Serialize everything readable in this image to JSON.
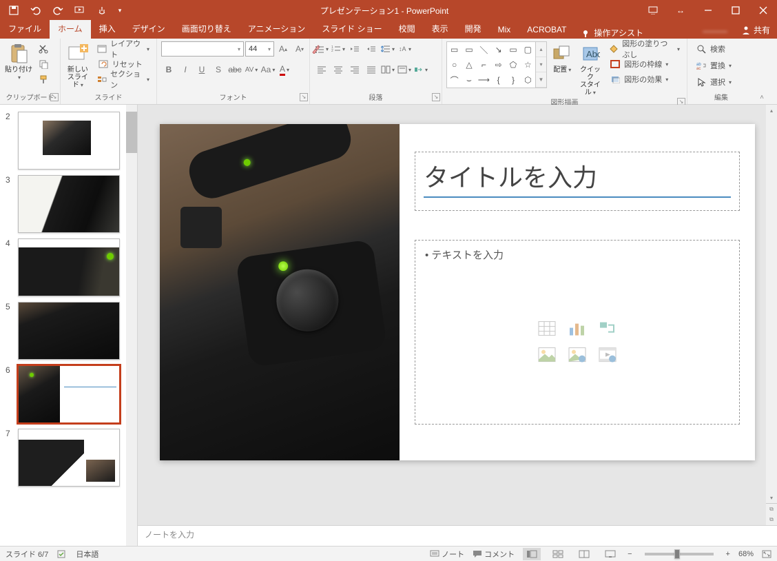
{
  "titlebar": {
    "title_doc": "プレゼンテーション1",
    "title_app": "PowerPoint"
  },
  "tabs": {
    "file": "ファイル",
    "home": "ホーム",
    "insert": "挿入",
    "design": "デザイン",
    "transitions": "画面切り替え",
    "animations": "アニメーション",
    "slideshow": "スライド ショー",
    "review": "校閲",
    "view": "表示",
    "developer": "開発",
    "mix": "Mix",
    "acrobat": "ACROBAT",
    "assist": "操作アシスト",
    "share": "共有"
  },
  "ribbon": {
    "clipboard": {
      "paste": "貼り付け",
      "label": "クリップボード"
    },
    "slides": {
      "new_slide": "新しい\nスライド",
      "layout": "レイアウト",
      "reset": "リセット",
      "section": "セクション",
      "label": "スライド"
    },
    "font": {
      "name": "",
      "size": "44",
      "label": "フォント"
    },
    "paragraph": {
      "label": "段落"
    },
    "drawing": {
      "arrange": "配置",
      "quickstyle": "クイック\nスタイル",
      "fill": "図形の塗りつぶし",
      "outline": "図形の枠線",
      "effects": "図形の効果",
      "label": "図形描画"
    },
    "editing": {
      "find": "検索",
      "replace": "置換",
      "select": "選択",
      "label": "編集"
    }
  },
  "thumbs": {
    "n2": "2",
    "n3": "3",
    "n4": "4",
    "n5": "5",
    "n6": "6",
    "n7": "7"
  },
  "slide": {
    "title_placeholder": "タイトルを入力",
    "content_placeholder": "テキストを入力"
  },
  "notes": {
    "placeholder": "ノートを入力"
  },
  "status": {
    "slide": "スライド 6/7",
    "lang": "日本語",
    "notes_btn": "ノート",
    "comments_btn": "コメント",
    "zoom": "68%"
  }
}
